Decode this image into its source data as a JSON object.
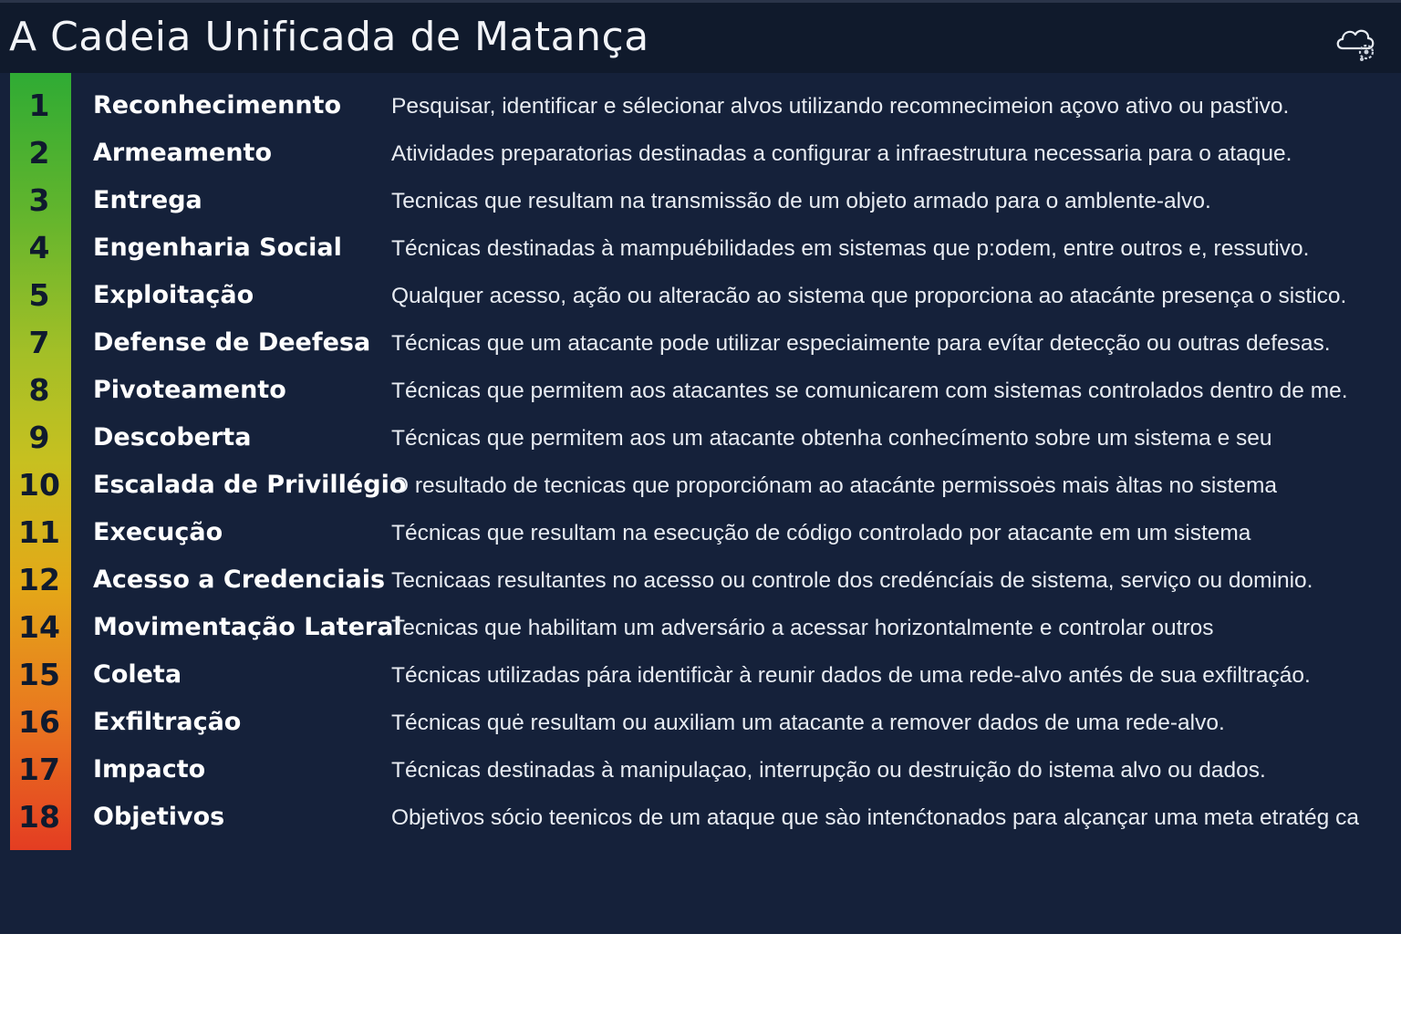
{
  "header": {
    "title": "A Cadeia Unificada de Matança",
    "icon": "cloud-gear-icon"
  },
  "colors": {
    "background": "#15213a",
    "header_background": "#101a2c",
    "gradient_top": "#2fab34",
    "gradient_middle": "#c7c020",
    "gradient_bottom": "#e43d22",
    "text": "#ffffff"
  },
  "phases": [
    {
      "num": "1",
      "name": "Reconhecimennto",
      "desc": "Pesquisar, identificar e sélecionar alvos utilizando recomnecimeion açovo ativo ou pasťivo."
    },
    {
      "num": "2",
      "name": "Armeamento",
      "desc": "Atividades preparatorias destinadas a configurar a infraestrutura necessaria para o ataque."
    },
    {
      "num": "3",
      "name": "Entrega",
      "desc": "Tecnicas que resultam na transmissão de um objeto armado para o amblente-alvo."
    },
    {
      "num": "4",
      "name": "Engenharia Social",
      "desc": "Técnicas destinadas à mampuébilidades em sistemas que  p:odem, entre outros e, ressutivo."
    },
    {
      "num": "5",
      "name": "Exploitação",
      "desc": "Qualquer acesso, ação ou alteracão ao sistema que proporciona ao atacánte presença o sistico."
    },
    {
      "num": "7",
      "name": "Defense de Deefesa",
      "desc": "Técnicas que um atacante pode utilizar especiaimente para evítar detecção ou outras defesas."
    },
    {
      "num": "8",
      "name": "Pivoteamento",
      "desc": "Técnicas que permitem aos atacantes se comunicarem com sistemas controlados dentro de me."
    },
    {
      "num": "9",
      "name": "Descoberta",
      "desc": "Técnicas que permitem aos um atacante obtenha conhecímento sobre um sistema e seu"
    },
    {
      "num": "10",
      "name": "Escalada de Privillégio",
      "desc": "O resultado de tecnicas que proporciónam ao atacánte permissoės mais àltas no sistema"
    },
    {
      "num": "11",
      "name": "Execução",
      "desc": "Técnicas que resultam na esecução de código controlado por atacante em um sistema"
    },
    {
      "num": "12",
      "name": "Acesso a Credenciais",
      "desc": "Tecnicaas resultantes no acesso ou controle dos credéncíais de sistema, serviço ou dominio."
    },
    {
      "num": "14",
      "name": "Movimentação Lateral",
      "desc": "Tecnicas que habilitam um adversário a acessar horizontalmente e controlar outros"
    },
    {
      "num": "15",
      "name": "Coleta",
      "desc": "Técnicas utilizadas pára identificàr à reunir dados de uma rede-alvo antés de sua exfiltraçáo."
    },
    {
      "num": "16",
      "name": "Exfiltração",
      "desc": "Técnicas quė resultam ou auxiliam um atacante a remover dados de uma rede-alvo."
    },
    {
      "num": "17",
      "name": "Impacto",
      "desc": "Técnicas destinadas à manipulaçao, interrupção ou destruição do istema alvo ou dados."
    },
    {
      "num": "18",
      "name": "Objetivos",
      "desc": "Objetivos sócio teenicos de um ataque que sào intenćtonados para alçançar uma meta etratég ca"
    }
  ]
}
